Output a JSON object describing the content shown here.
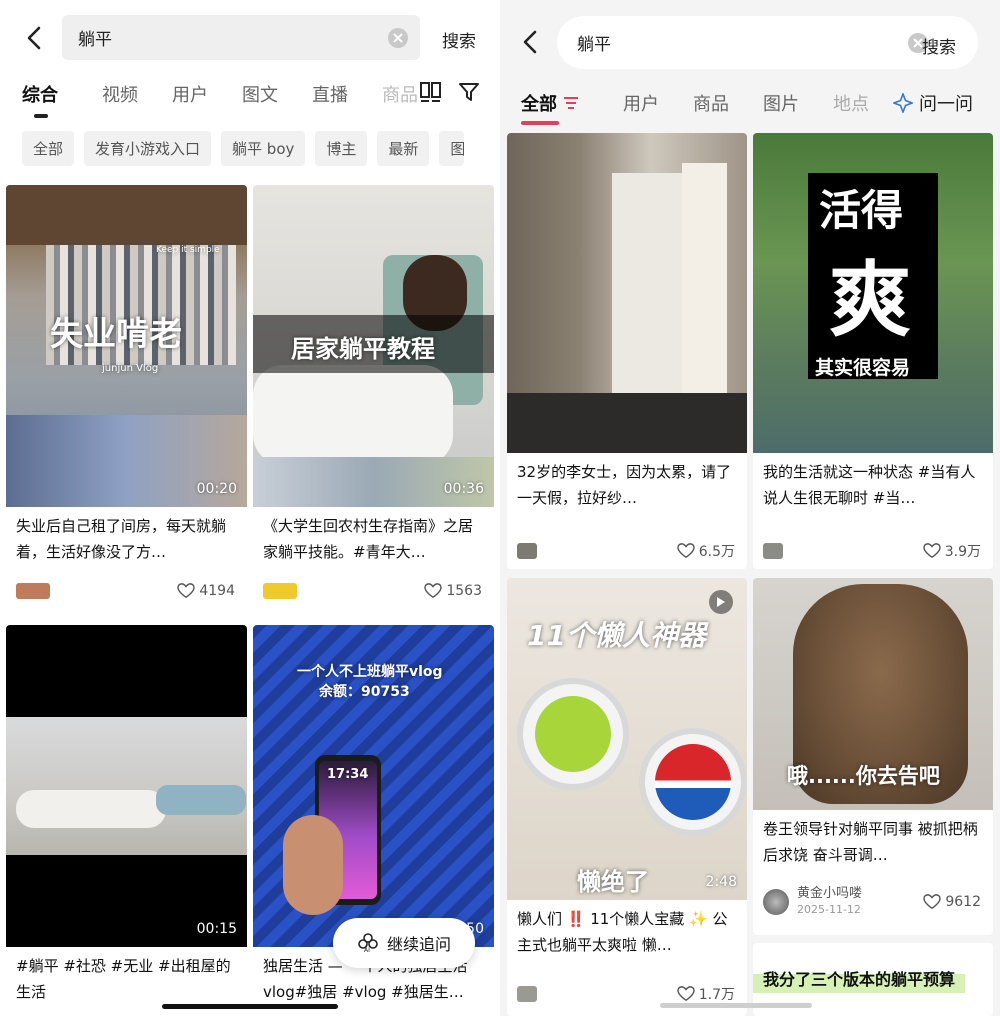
{
  "left": {
    "search_query": "躺平",
    "search_label": "搜索",
    "tabs": [
      "综合",
      "视频",
      "用户",
      "图文",
      "直播",
      "商品"
    ],
    "chips": [
      "全部",
      "发育小游戏入口",
      "躺平 boy",
      "博主",
      "最新",
      "图"
    ],
    "cards": [
      {
        "overlay": "失业啃老",
        "small_top": "Keep it simple",
        "small_caption": "junjun Vlog",
        "duration": "00:20",
        "title": "失业后自己租了间房，每天就躺着，生活好像没了方…",
        "likes": "4194"
      },
      {
        "overlay": "居家躺平教程",
        "duration": "00:36",
        "title": "《大学生回农村生存指南》之居家躺平技能。#青年大…",
        "likes": "1563"
      },
      {
        "duration": "00:15",
        "title": "#躺平 #社恐 #无业 #出租屋的生活"
      },
      {
        "overlay_line1": "一个人不上班躺平vlog",
        "overlay_line2": "余额：90753",
        "phone_time": "17:34",
        "duration": "0:50",
        "title": "独居生活 — 一个人的独居生活vlog#独居 #vlog #独居生…"
      }
    ],
    "continue_label": "继续追问"
  },
  "right": {
    "search_query": "躺平",
    "search_label": "搜索",
    "tabs": [
      "全部",
      "用户",
      "商品",
      "图片",
      "地点"
    ],
    "ask_label": "问一问",
    "cards": [
      {
        "title": "32岁的李女士，因为太累，请了一天假，拉好纱…",
        "likes": "6.5万"
      },
      {
        "overlay_a": "活得",
        "overlay_b": "爽",
        "overlay_c": "其实很容易",
        "title": "我的生活就这一种状态 #当有人说人生很无聊时 #当…",
        "likes": "3.9万"
      },
      {
        "overlay": "11个懒人神器",
        "overlay_bottom": "懒绝了",
        "duration": "2:48",
        "title": "懒人们 ‼️ 11个懒人宝藏 ✨ 公主式也躺平太爽啦 懒…",
        "likes": "1.7万"
      },
      {
        "overlay": "哦......你去告吧",
        "title": "卷王领导针对躺平同事 被抓把柄后求饶 奋斗哥调…",
        "author": "黄金小吗喽",
        "date": "2025-11-12",
        "likes": "9612"
      },
      {
        "title": "我分了三个版本的躺平预算"
      }
    ]
  }
}
